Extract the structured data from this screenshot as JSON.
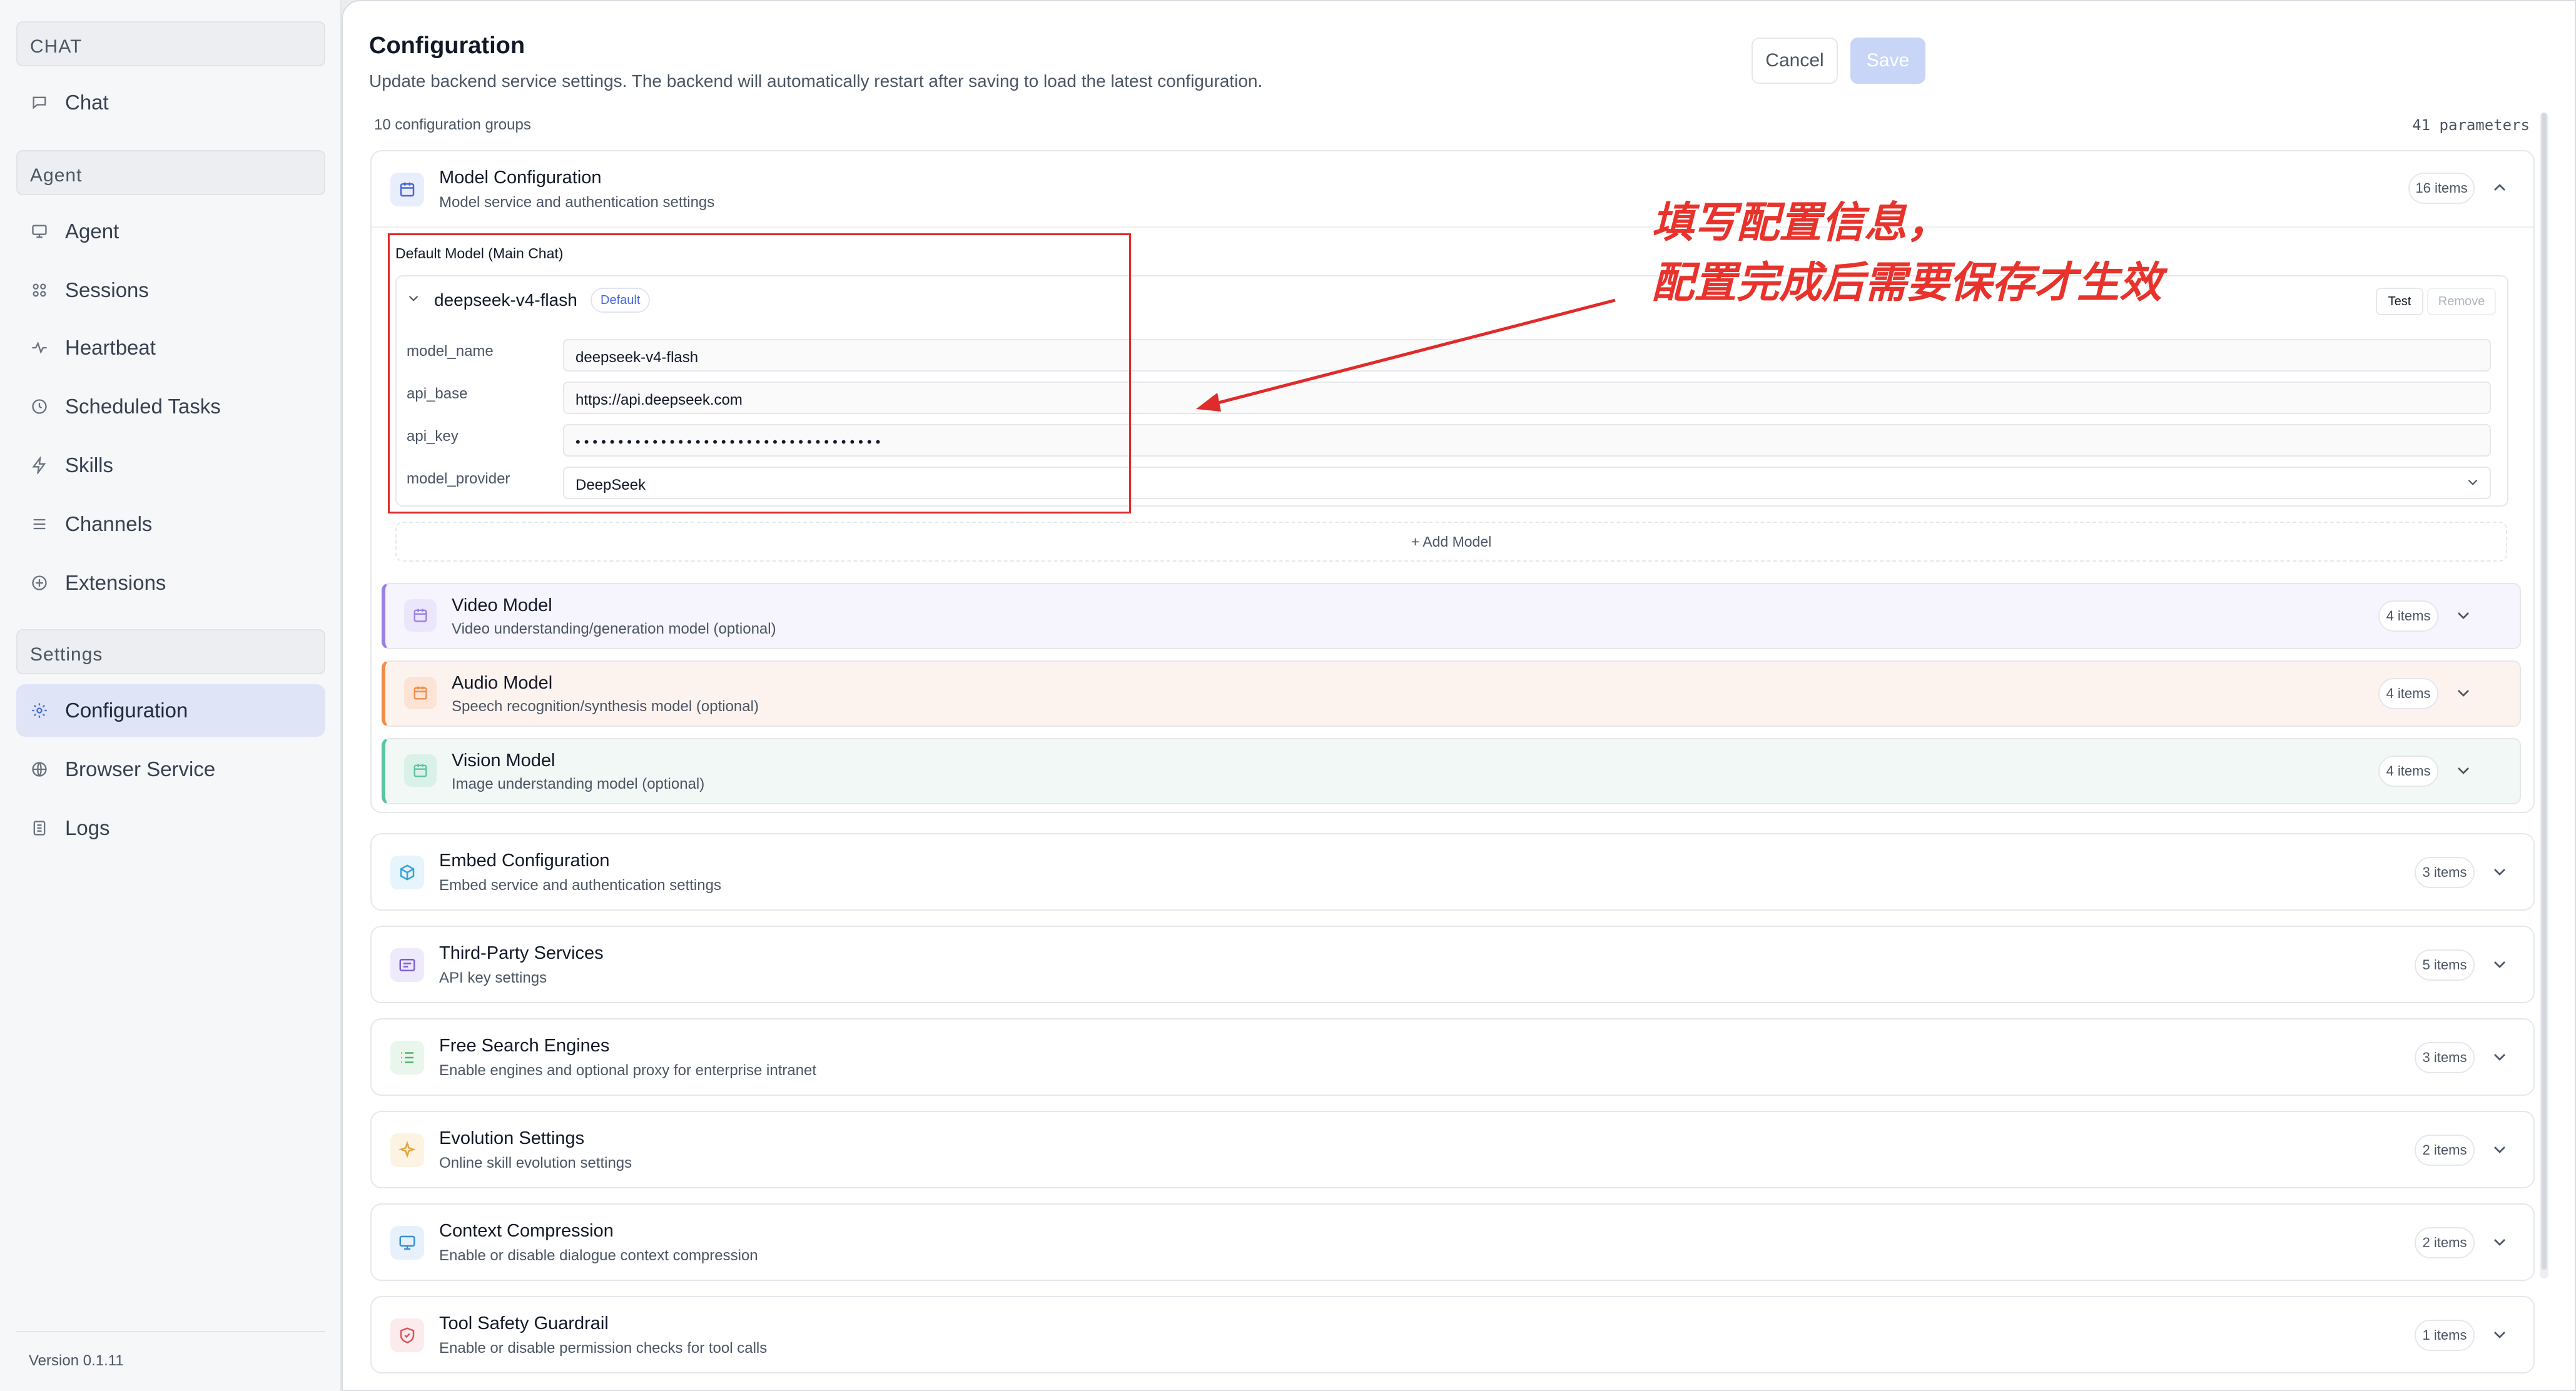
{
  "sidebar": {
    "sections": [
      {
        "title": "CHAT",
        "items": [
          {
            "label": "Chat",
            "icon": "chat-bubble-icon"
          }
        ]
      },
      {
        "title": "Agent",
        "items": [
          {
            "label": "Agent",
            "icon": "monitor-icon"
          },
          {
            "label": "Sessions",
            "icon": "sessions-icon"
          },
          {
            "label": "Heartbeat",
            "icon": "pulse-icon"
          },
          {
            "label": "Scheduled Tasks",
            "icon": "clock-icon"
          },
          {
            "label": "Skills",
            "icon": "bolt-icon"
          },
          {
            "label": "Channels",
            "icon": "list-icon"
          },
          {
            "label": "Extensions",
            "icon": "plus-circle-icon"
          }
        ]
      },
      {
        "title": "Settings",
        "items": [
          {
            "label": "Configuration",
            "icon": "gear-icon",
            "active": true
          },
          {
            "label": "Browser Service",
            "icon": "globe-icon"
          },
          {
            "label": "Logs",
            "icon": "document-icon"
          }
        ]
      }
    ],
    "version": "Version 0.1.11"
  },
  "header": {
    "title": "Configuration",
    "subtitle": "Update backend service settings. The backend will automatically restart after saving to load the latest configuration.",
    "cancel_label": "Cancel",
    "save_label": "Save",
    "groups_count": "10 configuration groups",
    "params_count": "41 parameters"
  },
  "model_config": {
    "title": "Model Configuration",
    "subtitle": "Model service and authentication settings",
    "badge": "16 items",
    "default_heading": "Default Model (Main Chat)",
    "model": {
      "name": "deepseek-v4-flash",
      "tag": "Default",
      "test_label": "Test",
      "remove_label": "Remove",
      "fields": [
        {
          "label": "model_name",
          "value": "deepseek-v4-flash"
        },
        {
          "label": "api_base",
          "value": "https://api.deepseek.com"
        },
        {
          "label": "api_key",
          "value": "••••••••••••••••••••••••••••••••••••"
        },
        {
          "label": "model_provider",
          "value": "DeepSeek"
        }
      ]
    },
    "add_model_label": "+ Add Model",
    "sub_models": [
      {
        "title": "Video Model",
        "subtitle": "Video understanding/generation model (optional)",
        "badge": "4 items",
        "accent": "#9b7fe6",
        "bg": "#f6f4fd"
      },
      {
        "title": "Audio Model",
        "subtitle": "Speech recognition/synthesis model (optional)",
        "badge": "4 items",
        "accent": "#f08c4a",
        "bg": "#fdf3ee"
      },
      {
        "title": "Vision Model",
        "subtitle": "Image understanding model (optional)",
        "badge": "4 items",
        "accent": "#5cc3a5",
        "bg": "#f1f8f5"
      }
    ]
  },
  "groups": [
    {
      "title": "Embed Configuration",
      "subtitle": "Embed service and authentication settings",
      "badge": "3 items",
      "icon": "cube-icon",
      "color": "#3aa3d8",
      "bg": "#e6f4fb"
    },
    {
      "title": "Third-Party Services",
      "subtitle": "API key settings",
      "badge": "5 items",
      "icon": "message-icon",
      "color": "#7c5ed6",
      "bg": "#efeafb"
    },
    {
      "title": "Free Search Engines",
      "subtitle": "Enable engines and optional proxy for enterprise intranet",
      "badge": "3 items",
      "icon": "list-icon",
      "color": "#4fb36a",
      "bg": "#e9f6ec"
    },
    {
      "title": "Evolution Settings",
      "subtitle": "Online skill evolution settings",
      "badge": "2 items",
      "icon": "sparkle-icon",
      "color": "#e8a23b",
      "bg": "#fdf3e3"
    },
    {
      "title": "Context Compression",
      "subtitle": "Enable or disable dialogue context compression",
      "badge": "2 items",
      "icon": "monitor-icon",
      "color": "#3b8fd6",
      "bg": "#e6f1fb"
    },
    {
      "title": "Tool Safety Guardrail",
      "subtitle": "Enable or disable permission checks for tool calls",
      "badge": "1 items",
      "icon": "shield-icon",
      "color": "#e0525a",
      "bg": "#fcebec"
    }
  ],
  "annotation": {
    "line1": "填写配置信息，",
    "line2": "配置完成后需要保存才生效",
    "color": "#e8332c"
  }
}
